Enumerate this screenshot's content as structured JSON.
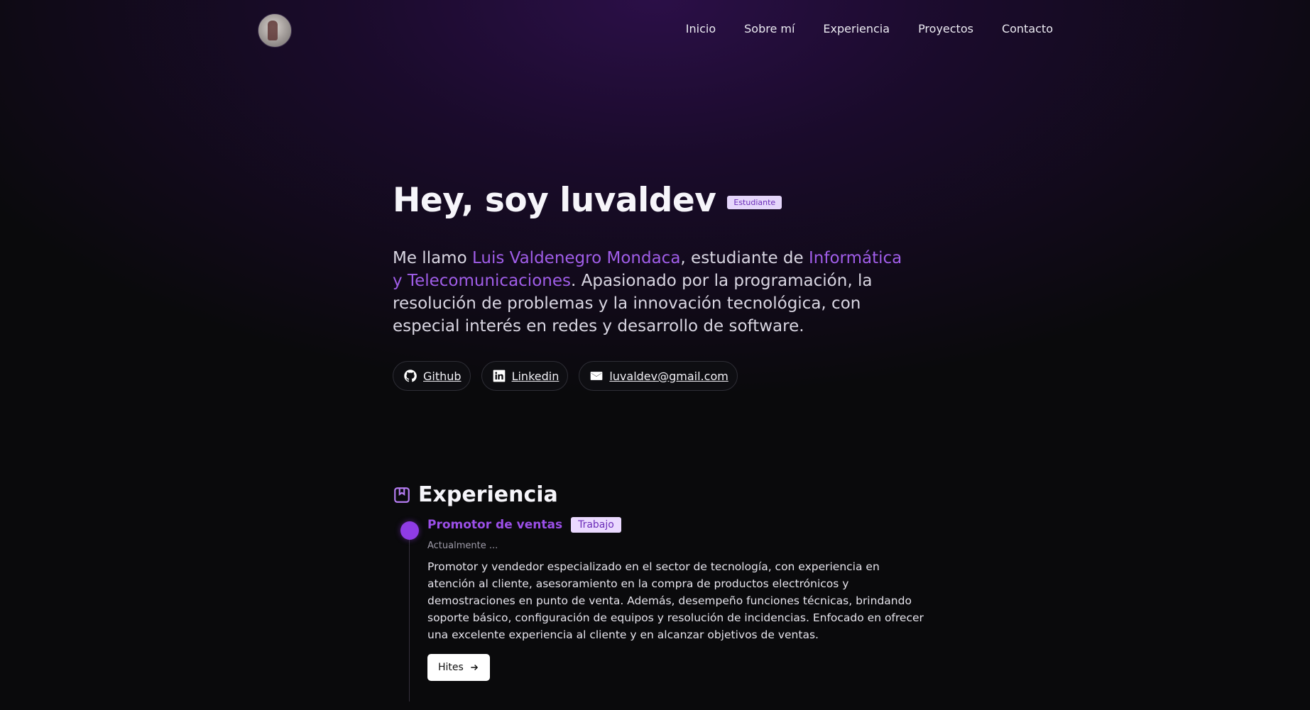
{
  "nav": {
    "avatar_alt": "luvaldev avatar",
    "links": [
      "Inicio",
      "Sobre mí",
      "Experiencia",
      "Proyectos",
      "Contacto"
    ]
  },
  "hero": {
    "title": "Hey, soy luvaldev",
    "badge": "Estudiante",
    "intro": {
      "p1": "Me llamo ",
      "name": "Luis Valdenegro Mondaca",
      "p2": ", estudiante de ",
      "career": "Informática y Telecomunicaciones",
      "p3": ". Apasionado por la programación, la resolución de problemas y la innovación tecnológica, con especial interés en redes y desarrollo de software."
    },
    "links": {
      "github": "Github",
      "linkedin": "Linkedin",
      "email": "luvaldev@gmail.com"
    }
  },
  "experience": {
    "heading": "Experiencia",
    "items": [
      {
        "title": "Promotor de ventas",
        "tag": "Trabajo",
        "date": "Actualmente ...",
        "description": "Promotor y vendedor especializado en el sector de tecnología, con experiencia en atención al cliente, asesoramiento en la compra de productos electrónicos y demostraciones en punto de venta. Además, desempeño funciones técnicas, brindando soporte básico, configuración de equipos y resolución de incidencias. Enfocado en ofrecer una excelente experiencia al cliente y en alcanzar objetivos de ventas.",
        "button": "Hites"
      }
    ]
  },
  "colors": {
    "accent": "#9b4fe8",
    "badge_bg": "#ead9ff",
    "background": "#0a0a0c"
  }
}
